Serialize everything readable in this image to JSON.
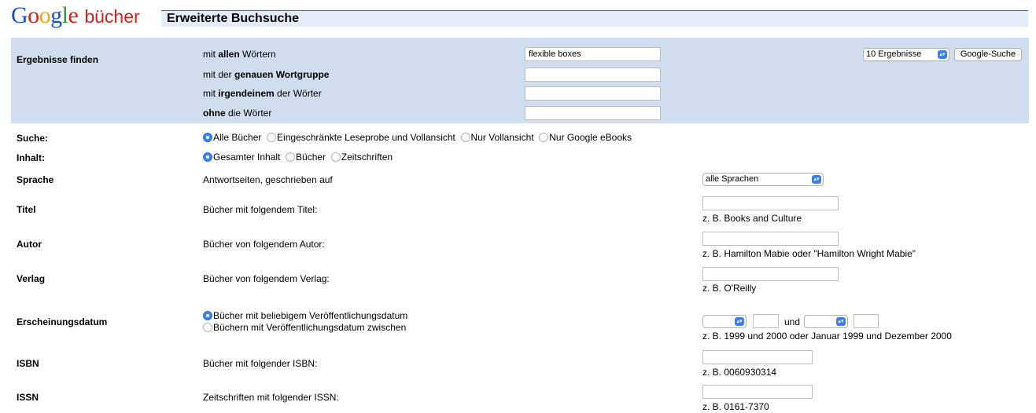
{
  "header": {
    "logo_text": "Google",
    "logo_sub": "bücher",
    "title": "Erweiterte Buchsuche"
  },
  "find": {
    "label": "Ergebnisse finden",
    "all_words": {
      "pre": "mit ",
      "bold": "allen",
      "post": " Wörtern",
      "value": "flexible boxes"
    },
    "exact": {
      "pre": "mit der ",
      "bold": "genauen Wortgruppe",
      "post": "",
      "value": ""
    },
    "any": {
      "pre": "mit ",
      "bold": "irgendeinem",
      "post": " der Wörter",
      "value": ""
    },
    "without": {
      "pre": "",
      "bold": "ohne",
      "post": " die Wörter",
      "value": ""
    },
    "results_select": "10 Ergebnisse",
    "search_button": "Google-Suche"
  },
  "suche": {
    "label": "Suche:",
    "options": [
      "Alle Bücher",
      "Eingeschränkte Leseprobe und Vollansicht",
      "Nur Vollansicht",
      "Nur Google eBooks"
    ],
    "selected": 0
  },
  "inhalt": {
    "label": "Inhalt:",
    "options": [
      "Gesamter Inhalt",
      "Bücher",
      "Zeitschriften"
    ],
    "selected": 0
  },
  "sprache": {
    "label": "Sprache",
    "desc": "Antwortseiten, geschrieben auf",
    "select": "alle Sprachen"
  },
  "titel": {
    "label": "Titel",
    "desc": "Bücher mit folgendem Titel:",
    "hint": "z. B. Books and Culture"
  },
  "autor": {
    "label": "Autor",
    "desc": "Bücher von folgendem Autor:",
    "hint": "z. B. Hamilton Mabie oder \"Hamilton Wright Mabie\""
  },
  "verlag": {
    "label": "Verlag",
    "desc": "Bücher von folgendem Verlag:",
    "hint": "z. B. O'Reilly"
  },
  "datum": {
    "label": "Erscheinungsdatum",
    "options": [
      "Bücher mit beliebigem Veröffentlichungsdatum",
      "Büchern mit Veröffentlichungsdatum zwischen"
    ],
    "selected": 0,
    "und": "und",
    "hint": "z. B. 1999 und 2000 oder Januar 1999 und Dezember 2000"
  },
  "isbn": {
    "label": "ISBN",
    "desc": "Bücher mit folgender ISBN:",
    "hint": "z. B. 0060930314"
  },
  "issn": {
    "label": "ISSN",
    "desc": "Zeitschriften mit folgender ISSN:",
    "hint": "z. B. 0161-7370"
  }
}
